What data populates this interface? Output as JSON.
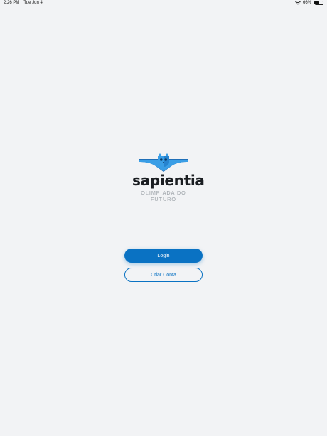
{
  "status_bar": {
    "time": "2:26 PM",
    "date": "Tue Jun 4",
    "battery": "66%",
    "battery_level": 0.66
  },
  "logo": {
    "wordmark": "sapientia",
    "tagline": "OLIMPIADA DO FUTURO"
  },
  "buttons": {
    "login_label": "Login",
    "create_account_label": "Criar Conta"
  },
  "colors": {
    "background": "#f2f3f5",
    "accent": "#0a72c3",
    "logo_blue": "#3a9ee6"
  }
}
